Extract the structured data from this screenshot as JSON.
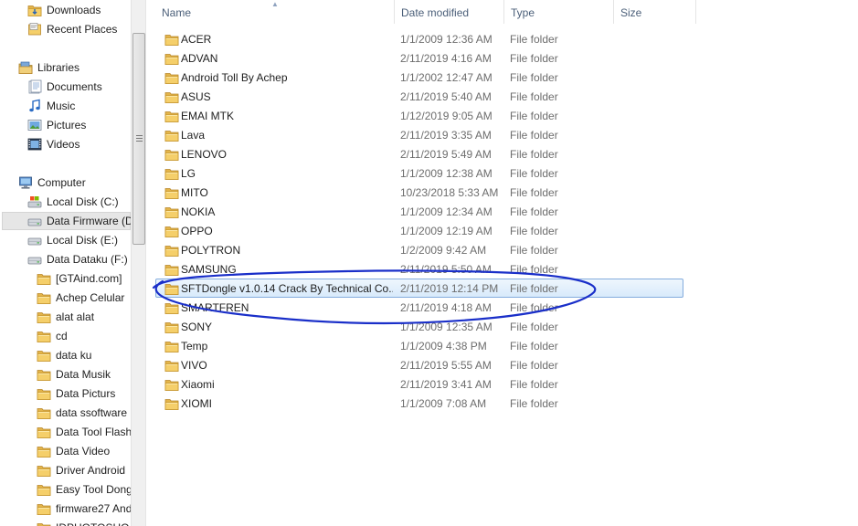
{
  "nav": {
    "items": [
      {
        "label": "Downloads",
        "icon": "downloads-folder-icon",
        "indent": 1
      },
      {
        "label": "Recent Places",
        "icon": "recent-places-icon",
        "indent": 1
      },
      {
        "label": "Libraries",
        "icon": "libraries-icon",
        "indent": 0
      },
      {
        "label": "Documents",
        "icon": "documents-icon",
        "indent": 1
      },
      {
        "label": "Music",
        "icon": "music-icon",
        "indent": 1
      },
      {
        "label": "Pictures",
        "icon": "pictures-icon",
        "indent": 1
      },
      {
        "label": "Videos",
        "icon": "videos-icon",
        "indent": 1
      },
      {
        "label": "Computer",
        "icon": "computer-icon",
        "indent": 0
      },
      {
        "label": "Local Disk (C:)",
        "icon": "system-disk-icon",
        "indent": 1
      },
      {
        "label": "Data Firmware (D",
        "icon": "drive-icon",
        "indent": 1,
        "selected": true
      },
      {
        "label": "Local Disk (E:)",
        "icon": "drive-icon",
        "indent": 1
      },
      {
        "label": "Data Dataku (F:)",
        "icon": "drive-icon",
        "indent": 1
      },
      {
        "label": "[GTAind.com]",
        "icon": "folder-icon",
        "indent": 2
      },
      {
        "label": "Achep Celular",
        "icon": "folder-icon",
        "indent": 2
      },
      {
        "label": "alat alat",
        "icon": "folder-icon",
        "indent": 2
      },
      {
        "label": "cd",
        "icon": "folder-icon",
        "indent": 2
      },
      {
        "label": "data ku",
        "icon": "folder-icon",
        "indent": 2
      },
      {
        "label": "Data Musik",
        "icon": "folder-icon",
        "indent": 2
      },
      {
        "label": "Data Picturs",
        "icon": "folder-icon",
        "indent": 2
      },
      {
        "label": "data ssoftware",
        "icon": "folder-icon",
        "indent": 2
      },
      {
        "label": "Data Tool Flash",
        "icon": "folder-icon",
        "indent": 2
      },
      {
        "label": "Data Video",
        "icon": "folder-icon",
        "indent": 2
      },
      {
        "label": "Driver Android",
        "icon": "folder-icon",
        "indent": 2
      },
      {
        "label": "Easy Tool Dong",
        "icon": "folder-icon",
        "indent": 2
      },
      {
        "label": "firmware27 And",
        "icon": "folder-icon",
        "indent": 2
      },
      {
        "label": "IDPHOTOSHO",
        "icon": "folder-icon",
        "indent": 2
      }
    ]
  },
  "columns": {
    "name": "Name",
    "date": "Date modified",
    "type": "Type",
    "size": "Size"
  },
  "files": [
    {
      "name": "ACER",
      "date": "1/1/2009 12:36 AM",
      "type": "File folder"
    },
    {
      "name": "ADVAN",
      "date": "2/11/2019 4:16 AM",
      "type": "File folder"
    },
    {
      "name": "Android Toll By Achep",
      "date": "1/1/2002 12:47 AM",
      "type": "File folder"
    },
    {
      "name": "ASUS",
      "date": "2/11/2019 5:40 AM",
      "type": "File folder"
    },
    {
      "name": "EMAI MTK",
      "date": "1/12/2019 9:05 AM",
      "type": "File folder"
    },
    {
      "name": "Lava",
      "date": "2/11/2019 3:35 AM",
      "type": "File folder"
    },
    {
      "name": "LENOVO",
      "date": "2/11/2019 5:49 AM",
      "type": "File folder"
    },
    {
      "name": "LG",
      "date": "1/1/2009 12:38 AM",
      "type": "File folder"
    },
    {
      "name": "MITO",
      "date": "10/23/2018 5:33 AM",
      "type": "File folder"
    },
    {
      "name": "NOKIA",
      "date": "1/1/2009 12:34 AM",
      "type": "File folder"
    },
    {
      "name": "OPPO",
      "date": "1/1/2009 12:19 AM",
      "type": "File folder"
    },
    {
      "name": "POLYTRON",
      "date": "1/2/2009 9:42 AM",
      "type": "File folder"
    },
    {
      "name": "SAMSUNG",
      "date": "2/11/2019 5:50 AM",
      "type": "File folder"
    },
    {
      "name": "SFTDongle v1.0.14 Crack By Technical Co...",
      "date": "2/11/2019 12:14 PM",
      "type": "File folder",
      "selected": true
    },
    {
      "name": "SMARTFREN",
      "date": "2/11/2019 4:18 AM",
      "type": "File folder"
    },
    {
      "name": "SONY",
      "date": "1/1/2009 12:35 AM",
      "type": "File folder"
    },
    {
      "name": "Temp",
      "date": "1/1/2009 4:38 PM",
      "type": "File folder"
    },
    {
      "name": "VIVO",
      "date": "2/11/2019 5:55 AM",
      "type": "File folder"
    },
    {
      "name": "Xiaomi",
      "date": "2/11/2019 3:41 AM",
      "type": "File folder"
    },
    {
      "name": "XIOMI",
      "date": "1/1/2009 7:08 AM",
      "type": "File folder"
    }
  ],
  "colors": {
    "annotation": "#1a2fc9",
    "selection_border": "#84acdd",
    "header_text": "#4c607a"
  }
}
